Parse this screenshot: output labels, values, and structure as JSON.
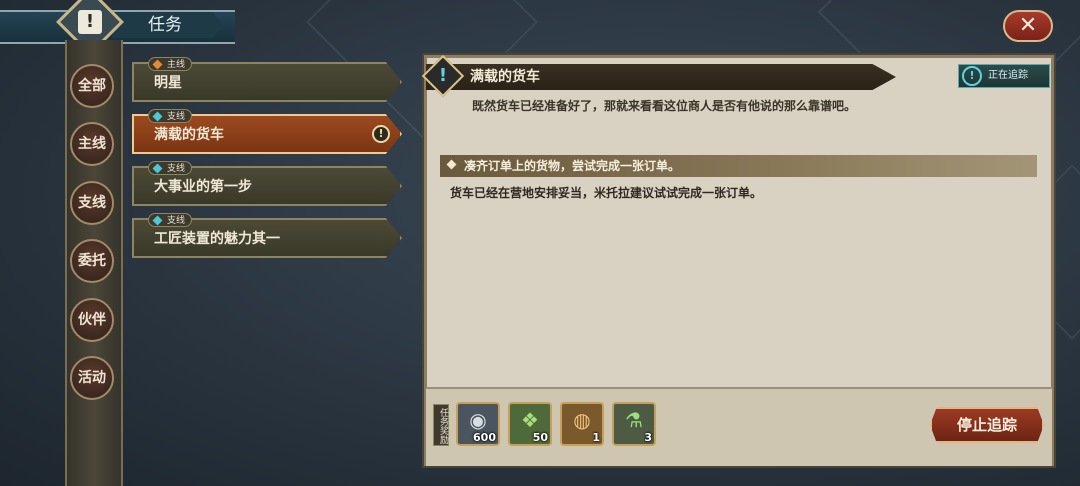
{
  "header": {
    "title": "任务",
    "emblem": "!",
    "emblem_icon": "quest-book-icon"
  },
  "close": {
    "label": "✕"
  },
  "categories": [
    {
      "label": "全部",
      "active": true
    },
    {
      "label": "主线",
      "active": false
    },
    {
      "label": "支线",
      "active": false
    },
    {
      "label": "委托",
      "active": false
    },
    {
      "label": "伙伴",
      "active": false
    },
    {
      "label": "活动",
      "active": false
    }
  ],
  "quests": [
    {
      "tag": "主线",
      "tag_color": "#e28a3a",
      "title": "明星",
      "selected": false,
      "tracked": false
    },
    {
      "tag": "支线",
      "tag_color": "#4fc6d6",
      "title": "满载的货车",
      "selected": true,
      "tracked": true
    },
    {
      "tag": "支线",
      "tag_color": "#4fc6d6",
      "title": "大事业的第一步",
      "selected": false,
      "tracked": false
    },
    {
      "tag": "支线",
      "tag_color": "#4fc6d6",
      "title": "工匠装置的魅力其一",
      "selected": false,
      "tracked": false
    }
  ],
  "track_marker": "!",
  "detail": {
    "icon": "!",
    "title": "满载的货车",
    "tracking_badge": "正在追踪",
    "tracking_icon": "!",
    "description": "既然货车已经准备好了，那就来看看这位商人是否有他说的那么靠谱吧。",
    "objective": "凑齐订单上的货物，尝试完成一张订单。",
    "objective_desc": "货车已经在营地安排妥当，米托拉建议试试完成一张订单。"
  },
  "rewards": {
    "label": "任务奖励",
    "items": [
      {
        "icon": "silver-coin-icon",
        "glyph": "◉",
        "count": "600",
        "bg": "#4a5560"
      },
      {
        "icon": "green-crystal-icon",
        "glyph": "❖",
        "count": "50",
        "bg": "#4f6a3a"
      },
      {
        "icon": "bread-basket-icon",
        "glyph": "◍",
        "count": "1",
        "bg": "#7a5a2c"
      },
      {
        "icon": "green-potion-icon",
        "glyph": "⚗",
        "count": "3",
        "bg": "#4d5a44"
      }
    ]
  },
  "stop_tracking": {
    "label": "停止追踪"
  },
  "colors": {
    "accent": "#9c4a1f",
    "tracking": "#5fd3e0",
    "panel": "#d9d2c2"
  }
}
